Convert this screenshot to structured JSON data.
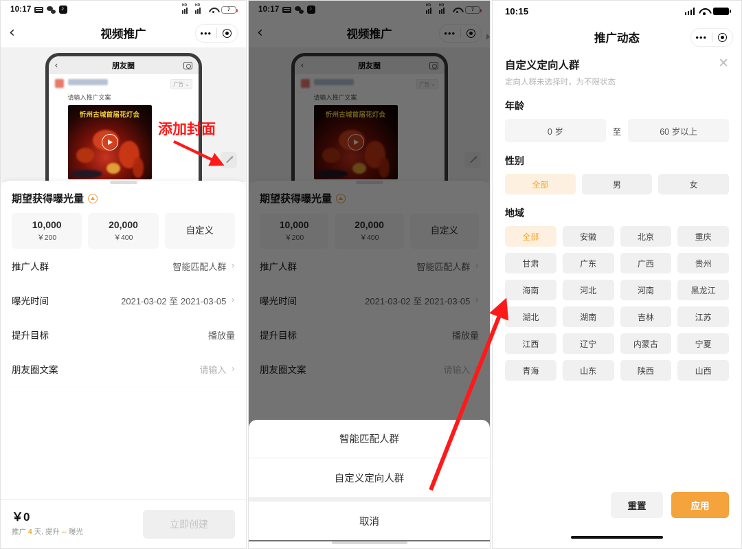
{
  "panel1": {
    "statusbar": {
      "time": "10:17",
      "icons": [
        "message-icon",
        "wechat-icon",
        "tiktok-icon",
        "hd-signal-icon",
        "hd-signal-icon",
        "wifi-icon",
        "battery-icon"
      ],
      "battery_level": "7"
    },
    "nav": {
      "back": "‹",
      "title": "视频推广",
      "dots": "•••",
      "target": "target-icon"
    },
    "preview": {
      "mock_nav_back": "‹",
      "mock_nav_title": "朋友圈",
      "mock_camera": "camera-icon",
      "ad_tag": "广告 ⌄",
      "copy_placeholder": "请输入推广文案",
      "media_title": "忻州古城首届花灯会",
      "play": "play-icon",
      "edit": "pencil-icon"
    },
    "sheet": {
      "section_title": "期望获得曝光量",
      "badge": "up-arrow-icon",
      "amounts": [
        {
          "big": "10,000",
          "sub": "￥200"
        },
        {
          "big": "20,000",
          "sub": "￥400"
        },
        {
          "big": "自定义",
          "sub": ""
        }
      ],
      "rows": [
        {
          "label": "推广人群",
          "value": "智能匹配人群",
          "chevron": true,
          "placeholder": false
        },
        {
          "label": "曝光时间",
          "value": "2021-03-02 至 2021-03-05",
          "chevron": true,
          "placeholder": false
        },
        {
          "label": "提升目标",
          "value": "播放量",
          "chevron": false,
          "placeholder": false
        },
        {
          "label": "朋友圈文案",
          "value": "请输入",
          "chevron": true,
          "placeholder": true
        }
      ]
    },
    "footer": {
      "price": "￥0",
      "note_prefix": "推广 ",
      "note_days": "4",
      "note_mid": " 天, 提升 ",
      "note_exposure": "--",
      "note_suffix": " 曝光",
      "create_button": "立即创建"
    }
  },
  "panel2": {
    "action_sheet": {
      "items": [
        "智能匹配人群",
        "自定义定向人群"
      ],
      "cancel": "取消"
    }
  },
  "panel3": {
    "statusbar": {
      "time": "10:15",
      "icons": [
        "cellular-icon",
        "wifi-icon",
        "battery-icon"
      ]
    },
    "nav": {
      "title": "推广动态",
      "dots": "•••",
      "target": "target-icon"
    },
    "header": {
      "title": "自定义定向人群",
      "subtitle": "定向人群未选择时，为不限状态",
      "close": "✕"
    },
    "age": {
      "group_title": "年龄",
      "from": "0 岁",
      "separator": "至",
      "to": "60 岁以上"
    },
    "gender": {
      "group_title": "性别",
      "options": [
        "全部",
        "男",
        "女"
      ],
      "selected": "全部"
    },
    "region": {
      "group_title": "地域",
      "options": [
        "全部",
        "安徽",
        "北京",
        "重庆",
        "甘肃",
        "广东",
        "广西",
        "贵州",
        "海南",
        "河北",
        "河南",
        "黑龙江",
        "湖北",
        "湖南",
        "吉林",
        "江苏",
        "江西",
        "辽宁",
        "内蒙古",
        "宁夏",
        "青海",
        "山东",
        "陕西",
        "山西"
      ],
      "selected": "全部"
    },
    "footer": {
      "reset": "重置",
      "apply": "应用"
    }
  },
  "annotations": {
    "add_cover": "添加封面",
    "accent_red": "#ff1a1a",
    "accent_orange": "#f5a623"
  }
}
